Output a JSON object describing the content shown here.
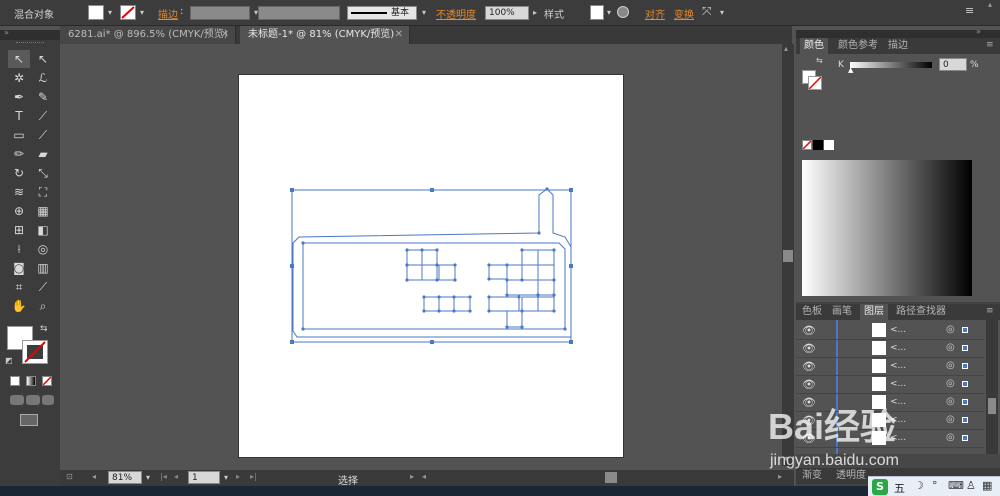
{
  "control_bar": {
    "selection_label": "混合对象",
    "stroke_label": "描边",
    "stroke_style": "基本",
    "opacity_label": "不透明度",
    "opacity_value": "100%",
    "style_label": "样式",
    "align_label": "对齐",
    "transform_label": "变换"
  },
  "doc_tabs": [
    {
      "label": "6281.ai* @ 896.5% (CMYK/预览)"
    },
    {
      "label": "未标题-1* @ 81% (CMYK/预览)"
    }
  ],
  "status_bar": {
    "zoom": "81%",
    "page": "1",
    "mode": "选择"
  },
  "color_panel": {
    "tabs": [
      "颜色",
      "颜色参考",
      "描边"
    ],
    "k_label": "K",
    "k_value": "0",
    "k_unit": "%"
  },
  "layers_panel": {
    "tabs": [
      "色板",
      "画笔",
      "图层",
      "路径查找器"
    ],
    "layer_items": [
      "<...",
      "<...",
      "<...",
      "<...",
      "<...",
      "<...",
      "<..."
    ],
    "bottom_tabs": [
      "渐变",
      "透明度"
    ]
  },
  "watermark": {
    "brand": "Bai经验",
    "url": "jingyan.baidu.com"
  },
  "taskbar": {
    "ime": "五"
  },
  "colors": {
    "accent_orange": "#e58a2e",
    "path_blue": "#4a78c6",
    "ui_dark": "#3c3c3c"
  }
}
